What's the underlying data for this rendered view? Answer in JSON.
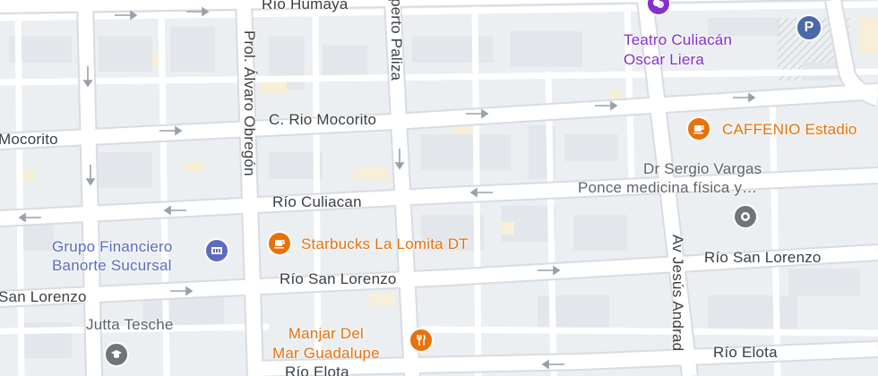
{
  "map": {
    "streets": {
      "rio_humaya": "Río Humaya",
      "prol_alvaro_obregon": "Prol. Álvaro Obregón",
      "roberto_paliza": "perto Paliza",
      "c_rio_mocorito": "C. Rio Mocorito",
      "mocorito_left": "Mocorito",
      "rio_culiacan": "Río Culiacan",
      "rio_san_lorenzo_mid": "Río San Lorenzo",
      "rio_san_lorenzo_right": "Río San Lorenzo",
      "san_lorenzo_left": "San Lorenzo",
      "av_jesus_andrade": "Av Jesús Andrad",
      "rio_elota_right": "Río Elota",
      "rio_elota_bottom": "Río Elota"
    },
    "pois": {
      "teatro": {
        "line1": "Teatro Culiacán",
        "line2": "Oscar Liera",
        "icon": "theater-icon",
        "color": "#8430ce"
      },
      "parking": {
        "label": "P",
        "icon": "parking-icon",
        "color": "#4a69a8"
      },
      "caffenio": {
        "label": "CAFFENIO Estadio",
        "icon": "coffee-icon",
        "color": "#e8710a"
      },
      "doctor": {
        "line1": "Dr Sergio Vargas",
        "line2": "Ponce medicina física y…",
        "icon": "place-icon",
        "color": "#70757a"
      },
      "banorte": {
        "line1": "Grupo Financiero",
        "line2": "Banorte Sucursal",
        "icon": "bank-icon",
        "color": "#5c6bc0"
      },
      "starbucks": {
        "label": "Starbucks La Lomita DT",
        "icon": "coffee-icon",
        "color": "#e8710a"
      },
      "manjar": {
        "line1": "Manjar Del",
        "line2": "Mar Guadalupe",
        "icon": "restaurant-icon",
        "color": "#e8710a"
      },
      "jutta": {
        "label": "Jutta Tesche",
        "icon": "school-icon",
        "color": "#70757a"
      }
    }
  }
}
